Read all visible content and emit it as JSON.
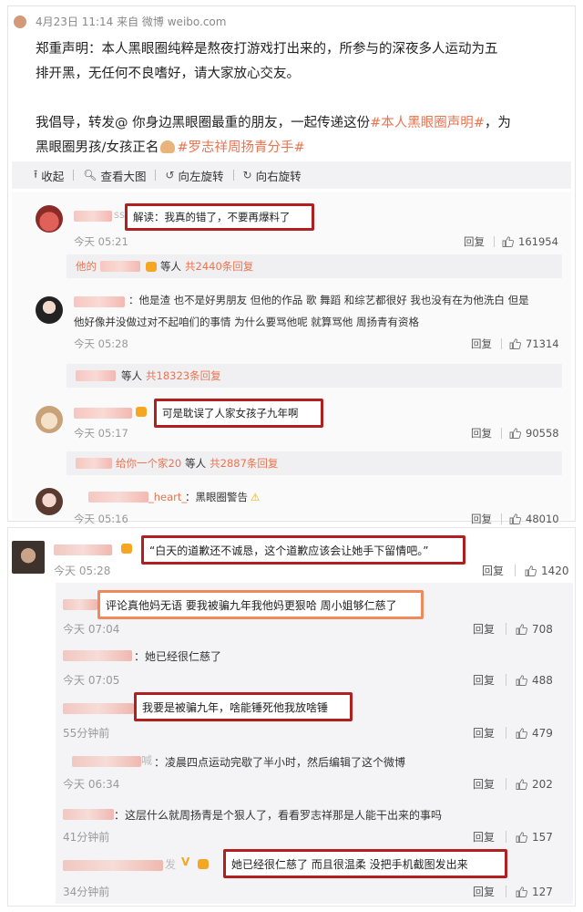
{
  "post": {
    "meta": "4月23日 11:14 来自 微博 weibo.com",
    "line1": "郑重声明：本人黑眼圈纯粹是熬夜打游戏打出来的，所参与的深夜多人运动为五",
    "line2": "排开黑，无任何不良嗜好，请大家放心交友。",
    "line3": "我倡导，转发@ 你身边黑眼圈最重的朋友，一起传递这份",
    "tag1": "#本人黑眼圈声明#",
    "line3_tail": "，为",
    "line4": "黑眼圈男孩/女孩正名",
    "tag2": "#罗志祥周扬青分手#"
  },
  "toolbar": {
    "collapse": "收起",
    "view_large": "查看大图",
    "rotate_left": "向左旋转",
    "rotate_right": "向右旋转"
  },
  "comments": [
    {
      "name_tail": "ss",
      "text": "解读：我真的错了，不要再爆料了",
      "time": "今天 05:21",
      "reply": "回复",
      "likes": "161954"
    },
    {
      "text": "：他是渣 也不是好男朋友 但他的作品 歌 舞蹈 和综艺都很好 我也没有在为他洗白 但是",
      "text2": "他好像并没做过对不起咱们的事情 为什么要骂他呢 就算骂他 周扬青有资格",
      "time": "今天 05:28",
      "reply": "回复",
      "likes": "71314"
    },
    {
      "text": "可是耽误了人家女孩子九年啊",
      "time": "今天 05:17",
      "reply": "回复",
      "likes": "90558"
    },
    {
      "name_tail": "_heart_",
      "text": "：黑眼圈警告",
      "emoji": "⚠",
      "time": "今天 05:16",
      "reply": "回复",
      "likes": "48010"
    }
  ],
  "sub_bars": [
    {
      "prefix": "他的",
      "mid": "等人",
      "count": "共2440条回复"
    },
    {
      "mid": "等人",
      "count": "共18323条回复"
    },
    {
      "prefix": "给你一个家20",
      "mid": "等人",
      "count": "共2887条回复"
    }
  ],
  "panel2": {
    "main": {
      "text": "“白天的道歉还不诚恳，这个道歉应该会让她手下留情吧。”",
      "time": "今天 05:28",
      "reply": "回复",
      "likes": "1420"
    },
    "subs": [
      {
        "text": "评论真他妈无语 要我被骗九年我他妈更狠哈 周小姐够仁慈了",
        "time": "今天 07:04",
        "reply": "回复",
        "likes": "708"
      },
      {
        "text": "：她已经很仁慈了",
        "time": "今天 07:05",
        "reply": "回复",
        "likes": "488"
      },
      {
        "text": "我要是被骗九年，啥能锤死他我放啥锤",
        "time": "55分钟前",
        "reply": "回复",
        "likes": "479"
      },
      {
        "name_tail": "喊",
        "text": "：凌晨四点运动完歇了半小时，然后编辑了这个微博",
        "time": "今天 06:34",
        "reply": "回复",
        "likes": "202"
      },
      {
        "text": "：这层什么就周扬青是个狠人了，看看罗志祥那是人能干出来的事吗",
        "time": "41分钟前",
        "reply": "回复",
        "likes": "157"
      },
      {
        "name_tail": "发",
        "text": "她已经很仁慈了 而且很温柔 没把手机截图发出来",
        "time": "34分钟前",
        "reply": "回复",
        "likes": "127"
      }
    ]
  }
}
